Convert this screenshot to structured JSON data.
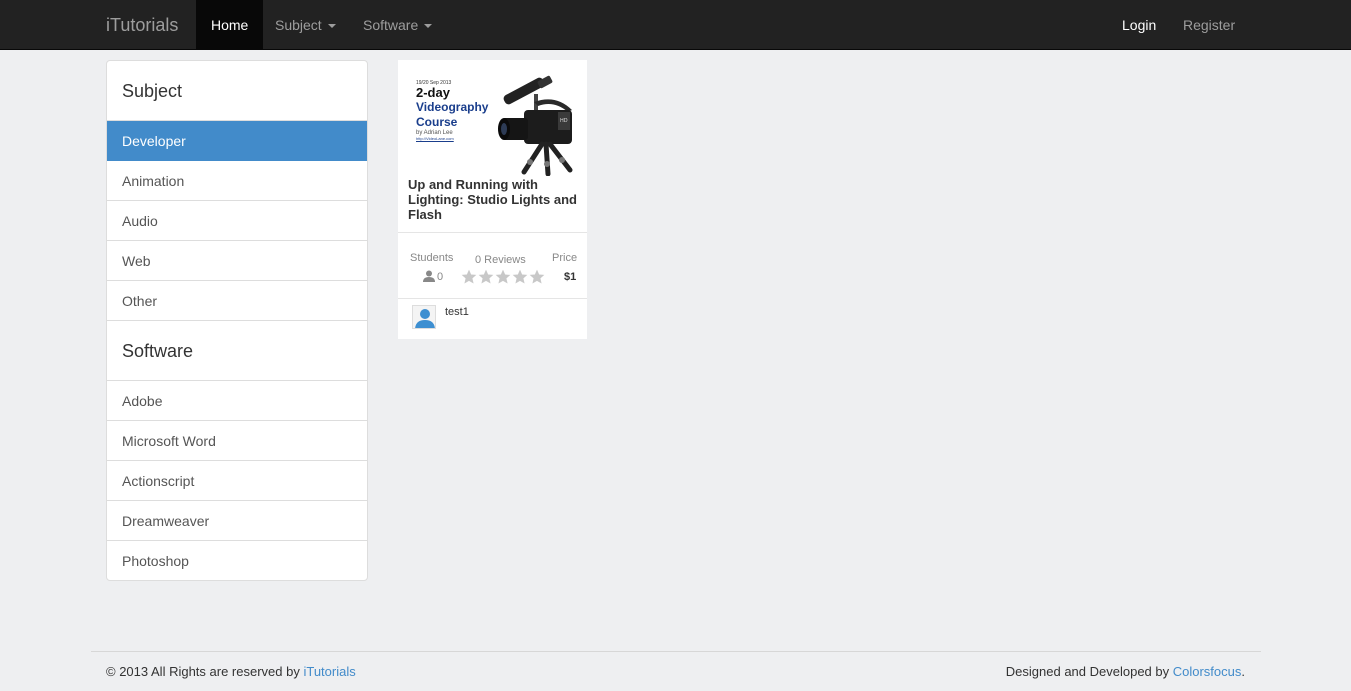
{
  "navbar": {
    "brand": "iTutorials",
    "items": [
      {
        "label": "Home",
        "active": true
      },
      {
        "label": "Subject",
        "dropdown": true
      },
      {
        "label": "Software",
        "dropdown": true
      }
    ],
    "right": [
      {
        "label": "Login"
      },
      {
        "label": "Register"
      }
    ]
  },
  "sidebar": {
    "subject_heading": "Subject",
    "subject_items": [
      "Developer",
      "Animation",
      "Audio",
      "Web",
      "Other"
    ],
    "software_heading": "Software",
    "software_items": [
      "Adobe",
      "Microsoft Word",
      "Actionscript",
      "Dreamweaver",
      "Photoshop"
    ]
  },
  "course": {
    "thumb": {
      "date": "19/20 Sep 2013",
      "line1": "2-day",
      "line2": "Videography",
      "line3": "Course",
      "by": "by Adrian Lee",
      "url": "http://VideoLane.com"
    },
    "title": "Up and Running with Lighting: Studio Lights and Flash",
    "students_label": "Students",
    "students_count": "0",
    "reviews_label": "0 Reviews",
    "rating": 0,
    "price_label": "Price",
    "price": "$1",
    "author": "test1"
  },
  "footer": {
    "left_text": "© 2013 All Rights are reserved by ",
    "left_link": "iTutorials",
    "right_text": "Designed and Developed by ",
    "right_link": "Colorsfocus",
    "right_suffix": "."
  },
  "colors": {
    "navbar_bg": "#222222",
    "accent": "#428bca",
    "page_bg": "#eeeff1"
  }
}
